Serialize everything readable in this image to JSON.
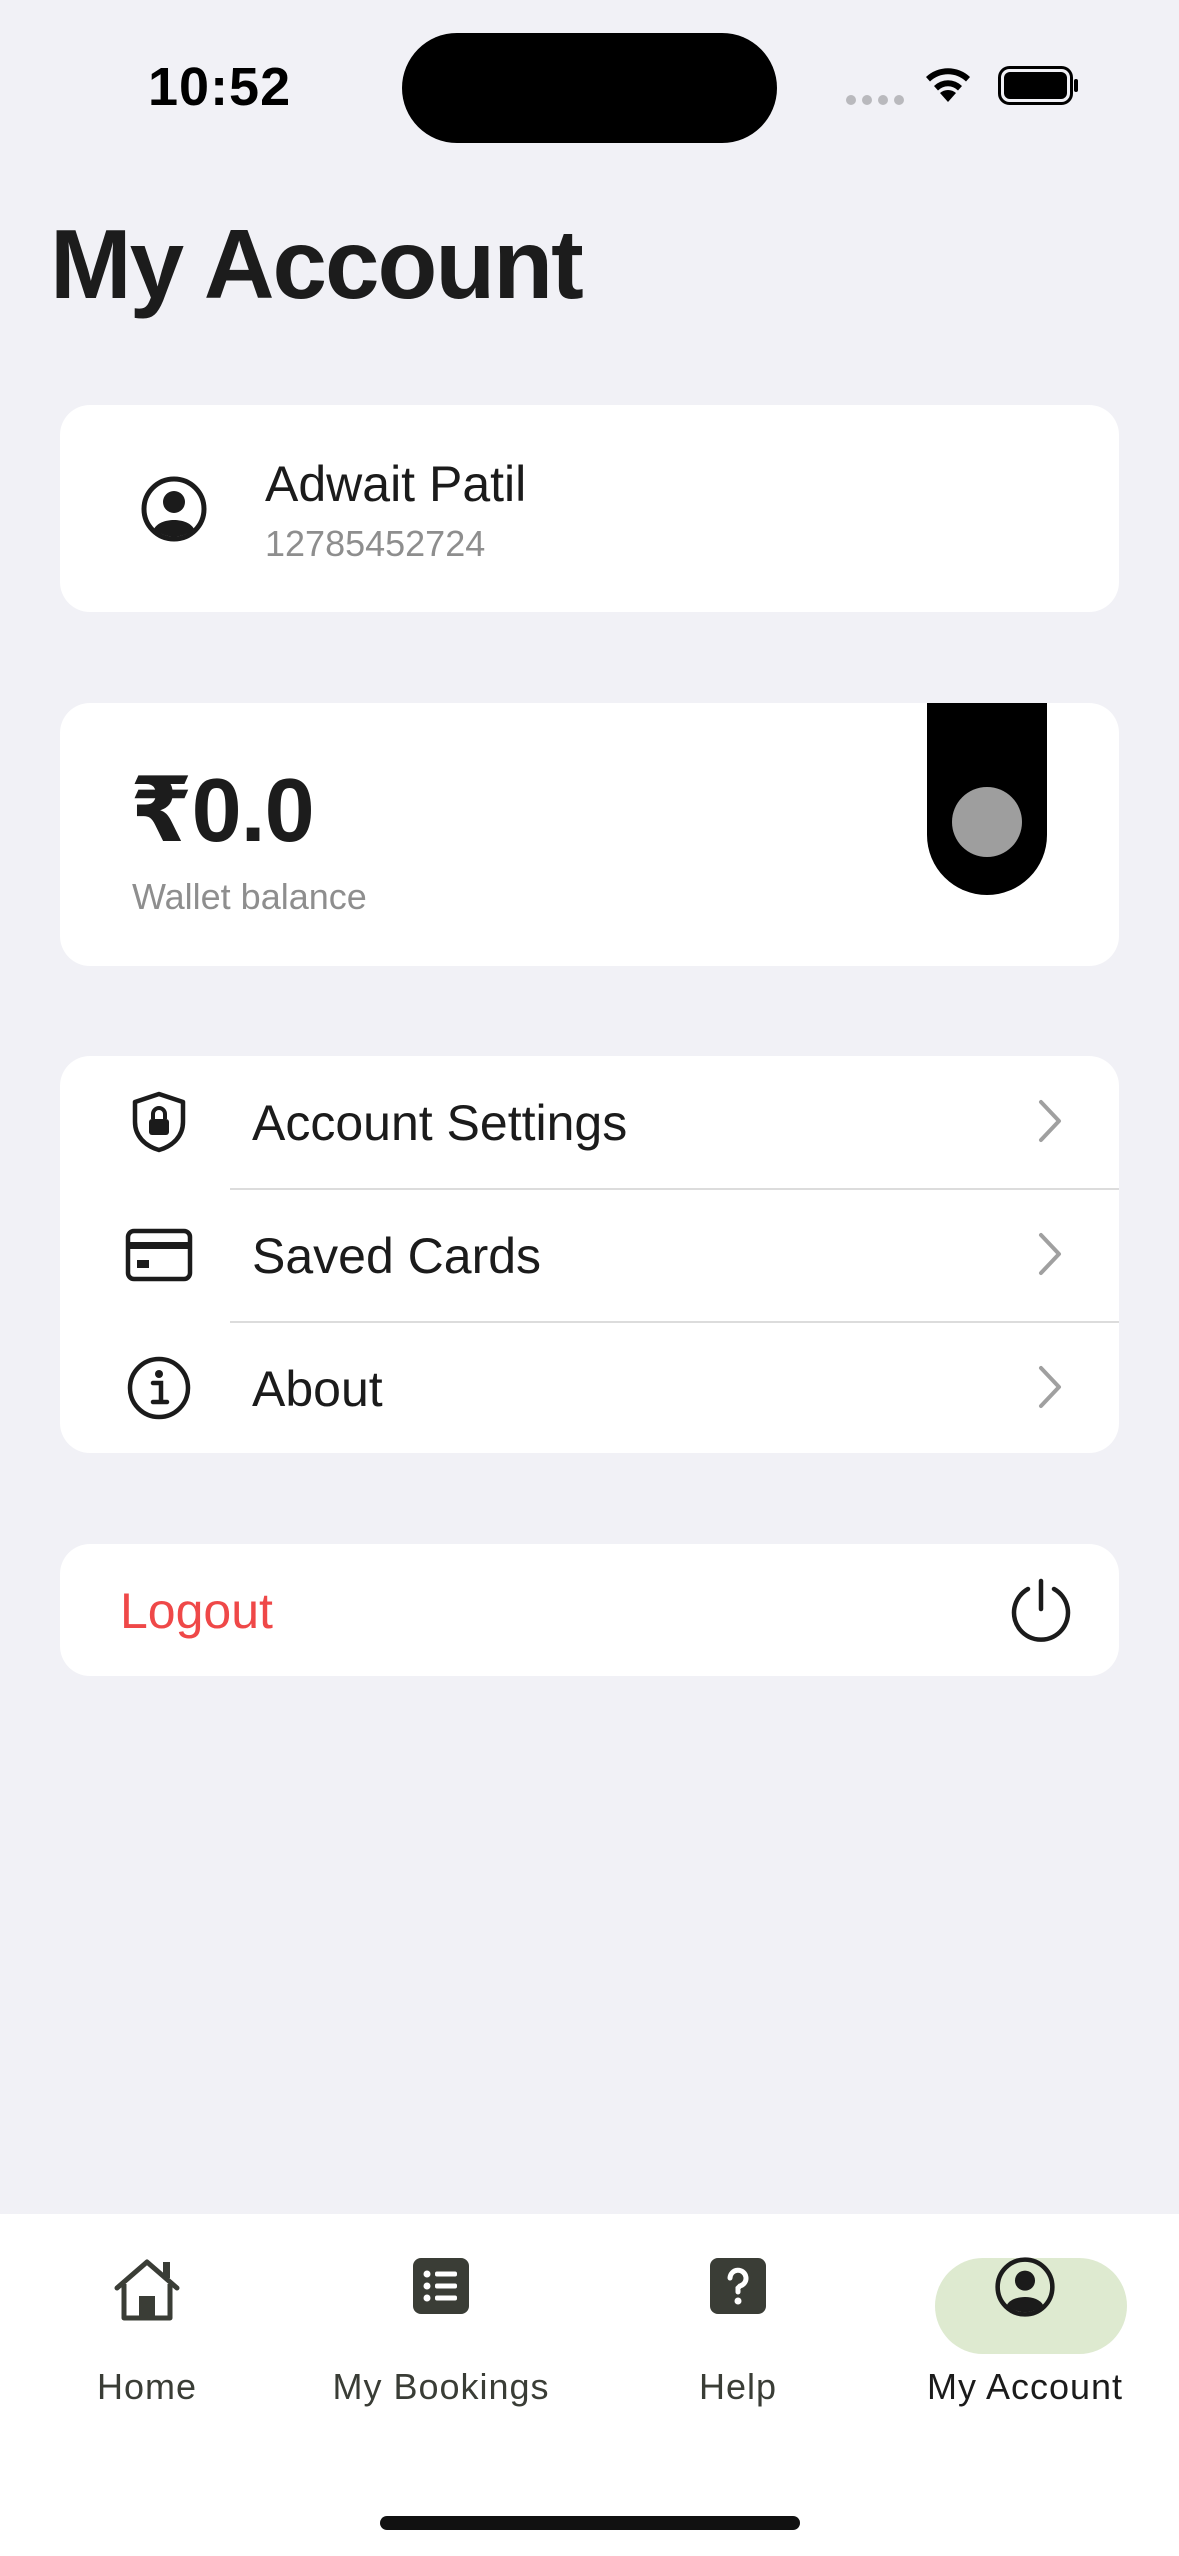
{
  "status_bar": {
    "time": "10:52"
  },
  "page_title": "My Account",
  "profile": {
    "name": "Adwait Patil",
    "phone": "12785452724",
    "icon": "user-circle-icon"
  },
  "wallet": {
    "amount": "₹0.0",
    "label": "Wallet balance"
  },
  "menu": {
    "items": [
      {
        "label": "Account Settings",
        "icon": "shield-lock-icon"
      },
      {
        "label": "Saved Cards",
        "icon": "credit-card-icon"
      },
      {
        "label": "About",
        "icon": "info-icon"
      }
    ]
  },
  "logout": {
    "label": "Logout",
    "icon": "power-icon",
    "color": "#ef4848"
  },
  "tab_bar": {
    "tabs": [
      {
        "label": "Home",
        "icon": "home-icon"
      },
      {
        "label": "My Bookings",
        "icon": "list-icon"
      },
      {
        "label": "Help",
        "icon": "help-icon"
      },
      {
        "label": "My Account",
        "icon": "user-circle-icon",
        "active": true
      }
    ],
    "active_color": "#deead0"
  }
}
